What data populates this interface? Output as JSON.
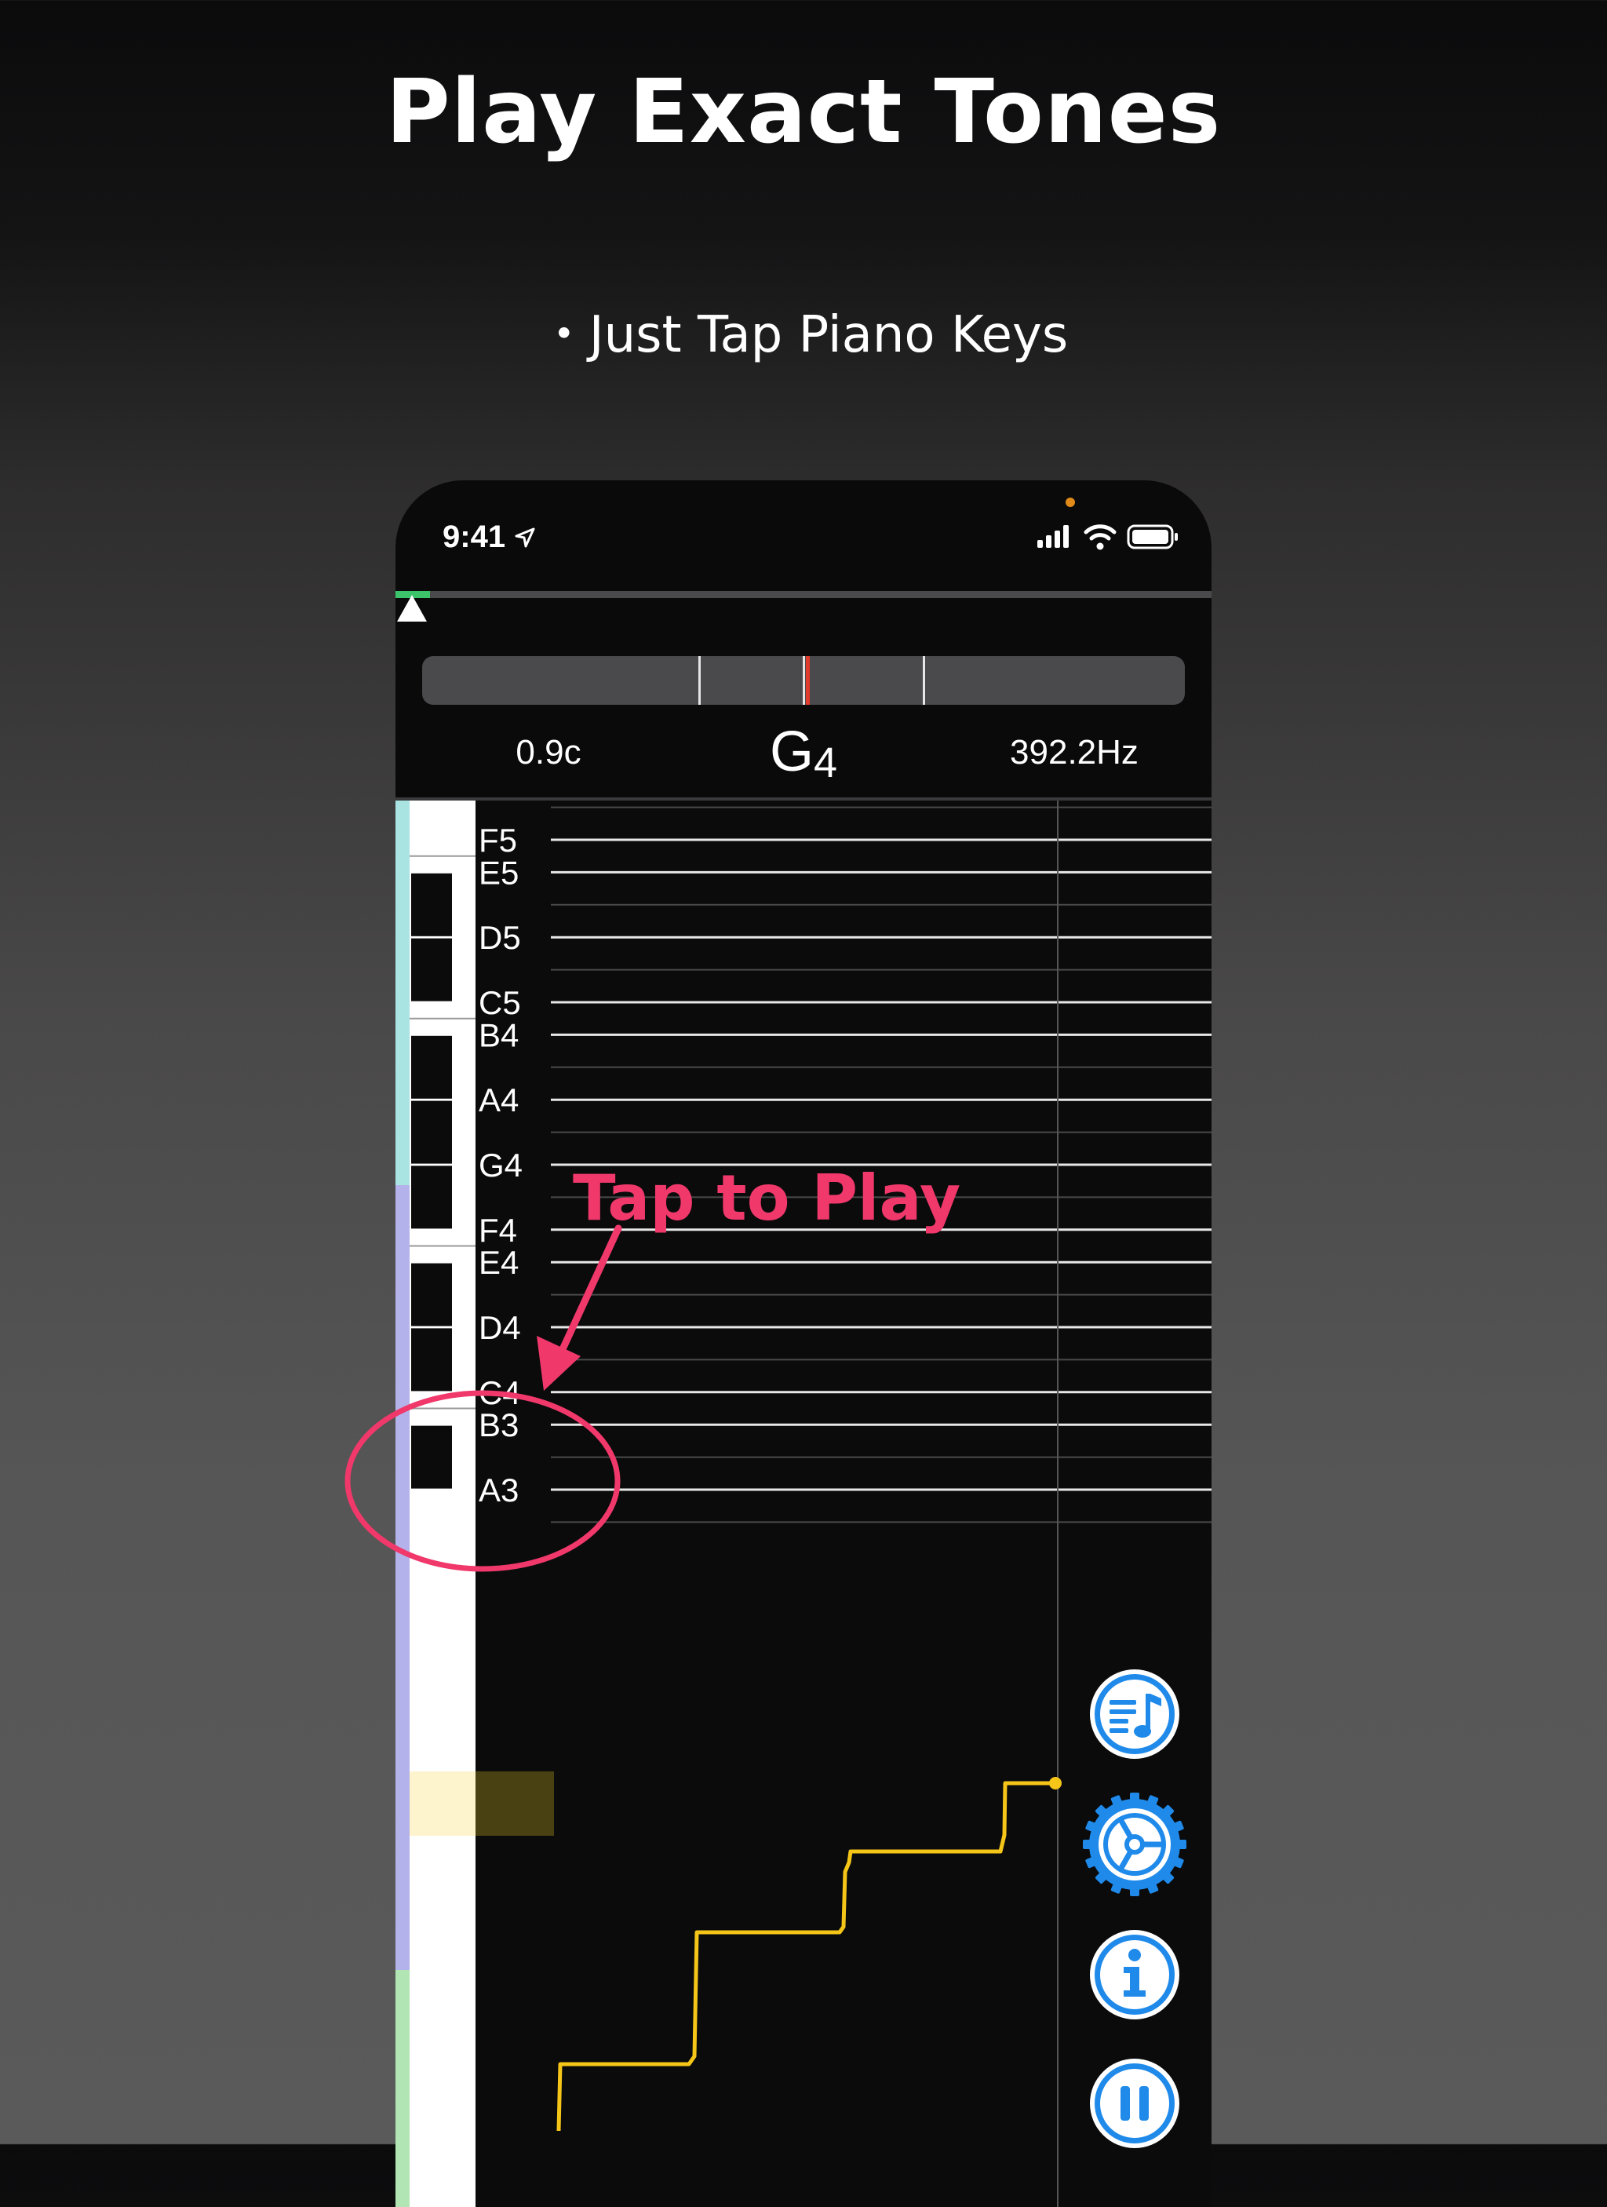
{
  "promo": {
    "headline": "Play Exact Tones",
    "subline": "・Just Tap Piano Keys"
  },
  "status_bar": {
    "time": "9:41",
    "icons": [
      "location-arrow-icon",
      "signal-bars-icon",
      "wifi-icon",
      "battery-icon"
    ]
  },
  "tuner": {
    "cents": "0.9c",
    "note": "G",
    "octave": "4",
    "frequency": "392.2Hz"
  },
  "piano_roll": {
    "labels": [
      "F5",
      "E5",
      "D5",
      "C5",
      "B4",
      "A4",
      "G4",
      "F4",
      "E4",
      "D4",
      "C4",
      "B3",
      "A3"
    ],
    "highlighted_key": "G4",
    "annotation": "Tap to Play",
    "accent_color": "#f0386b",
    "trace_color": "#f5c518",
    "trace_notes": [
      "C4",
      "D4",
      "E4",
      "F4",
      "G4"
    ]
  },
  "side_buttons": [
    {
      "name": "playlist-icon"
    },
    {
      "name": "settings-gear-icon"
    },
    {
      "name": "info-icon"
    },
    {
      "name": "pause-icon"
    }
  ]
}
